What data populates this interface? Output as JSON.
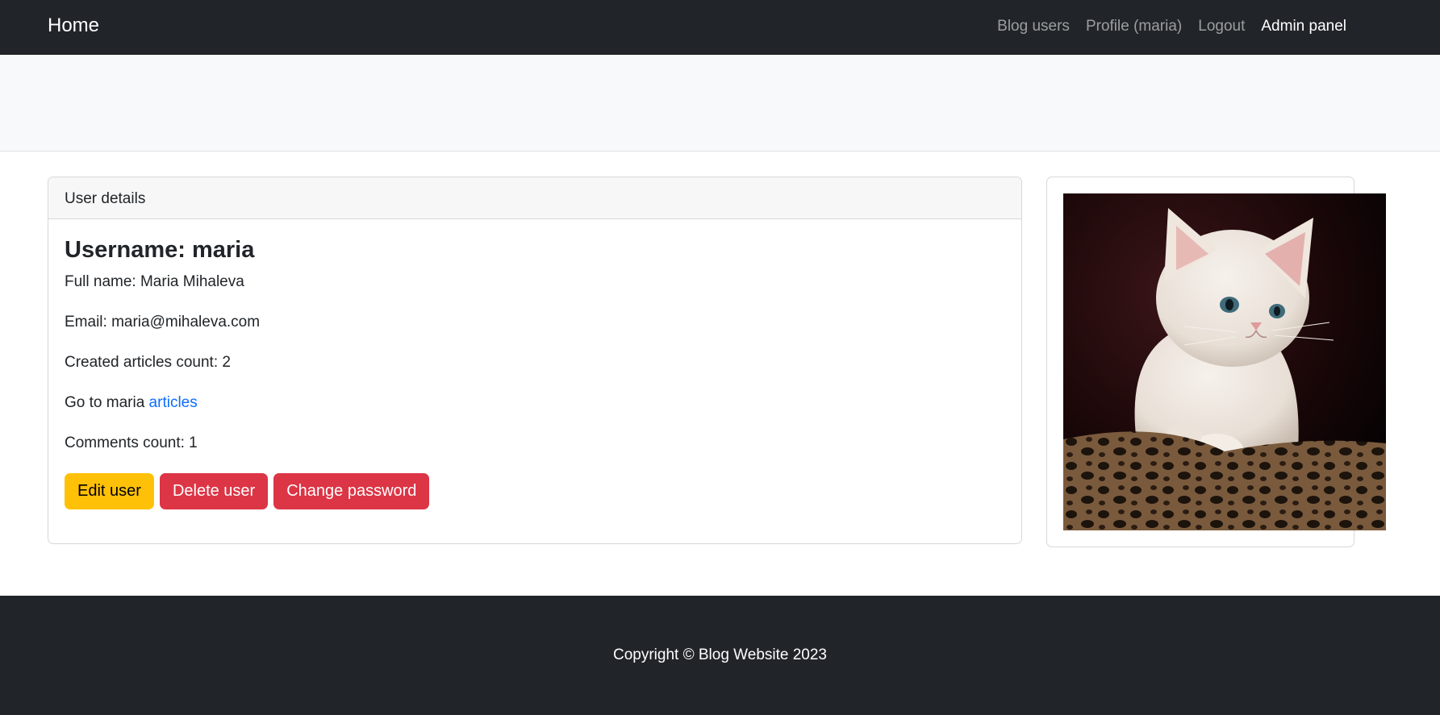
{
  "navbar": {
    "brand": "Home",
    "links": [
      {
        "label": "Blog users"
      },
      {
        "label": "Profile (maria)"
      },
      {
        "label": "Logout"
      },
      {
        "label": "Admin panel"
      }
    ]
  },
  "card": {
    "header": "User details",
    "title": "Username: maria",
    "full_name": "Full name: Maria Mihaleva",
    "email": "Email: maria@mihaleva.com",
    "articles_count": "Created articles count: 2",
    "goto_prefix": "Go to maria ",
    "goto_link": "articles",
    "comments_count": "Comments count: 1",
    "buttons": {
      "edit": "Edit user",
      "delete": "Delete user",
      "change_password": "Change password"
    }
  },
  "footer": {
    "copyright": "Copyright © Blog Website 2023"
  },
  "colors": {
    "navbar_bg": "#212529",
    "link_blue": "#0d6efd",
    "warning": "#ffc107",
    "danger": "#dc3545"
  }
}
